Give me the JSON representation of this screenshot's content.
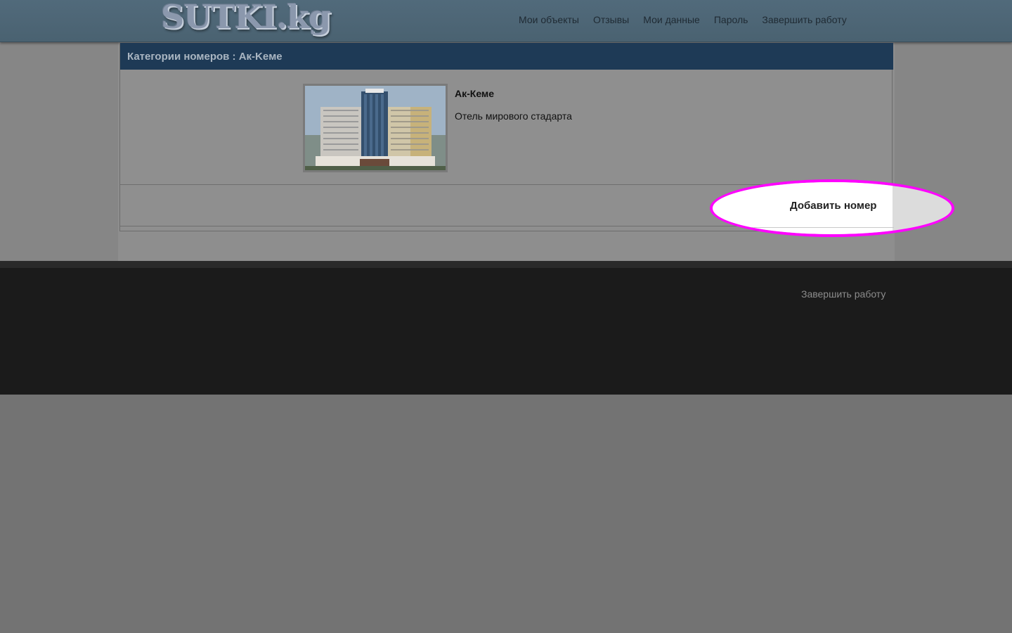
{
  "header": {
    "logo_text": "SUTKI.kg",
    "nav": [
      {
        "label": "Мои объекты"
      },
      {
        "label": "Отзывы"
      },
      {
        "label": "Мои данные"
      },
      {
        "label": "Пароль"
      },
      {
        "label": "Завершить работу"
      }
    ]
  },
  "panel": {
    "title": "Категории номеров : Ак-Keме",
    "hotel": {
      "name": "Ак-Кеме",
      "description": "Отель мирового стадарта"
    },
    "add_button_label": "Добавить номер",
    "highlight_color": "#ff00ff",
    "header_color": "#1e3a56"
  },
  "footer": {
    "logout_label": "Завершить работу"
  }
}
